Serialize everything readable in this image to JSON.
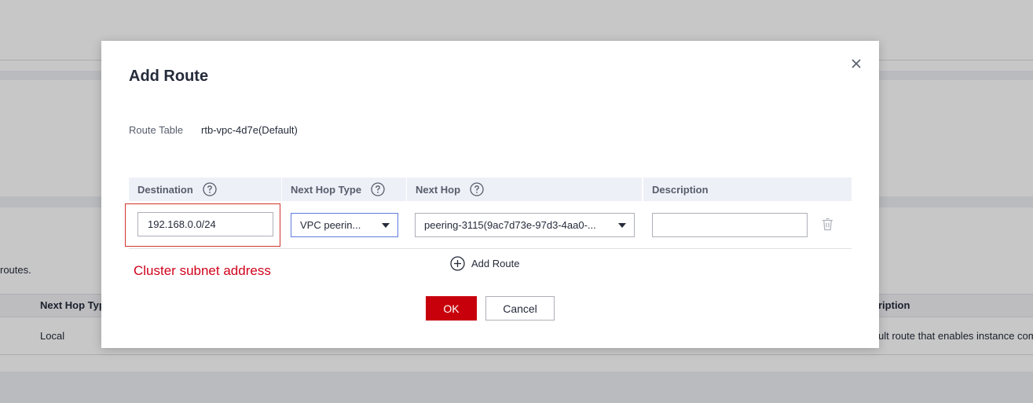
{
  "background": {
    "routes_text": "routes.",
    "col_next_hop_type": "Next Hop Typ",
    "col_description": "ription",
    "row_next_hop_type": "Local",
    "row_description": "ult route that enables instance com"
  },
  "dialog": {
    "title": "Add Route",
    "route_table_label": "Route Table",
    "route_table_value": "rtb-vpc-4d7e(Default)",
    "columns": {
      "destination": "Destination",
      "next_hop_type": "Next Hop Type",
      "next_hop": "Next Hop",
      "description": "Description"
    },
    "row": {
      "destination": "192.168.0.0/24",
      "next_hop_type": "VPC peerin...",
      "next_hop": "peering-3115(9ac7d73e-97d3-4aa0-...",
      "description": ""
    },
    "annotation": "Cluster subnet address",
    "add_route_label": "Add Route",
    "ok_label": "OK",
    "cancel_label": "Cancel"
  },
  "colors": {
    "primary": "#c7000b",
    "annotation": "#d0021b",
    "focus_border": "#5e7ce0"
  },
  "icons": [
    "close-icon",
    "help-icon",
    "caret-down-icon",
    "trash-icon",
    "plus-circle-icon"
  ]
}
